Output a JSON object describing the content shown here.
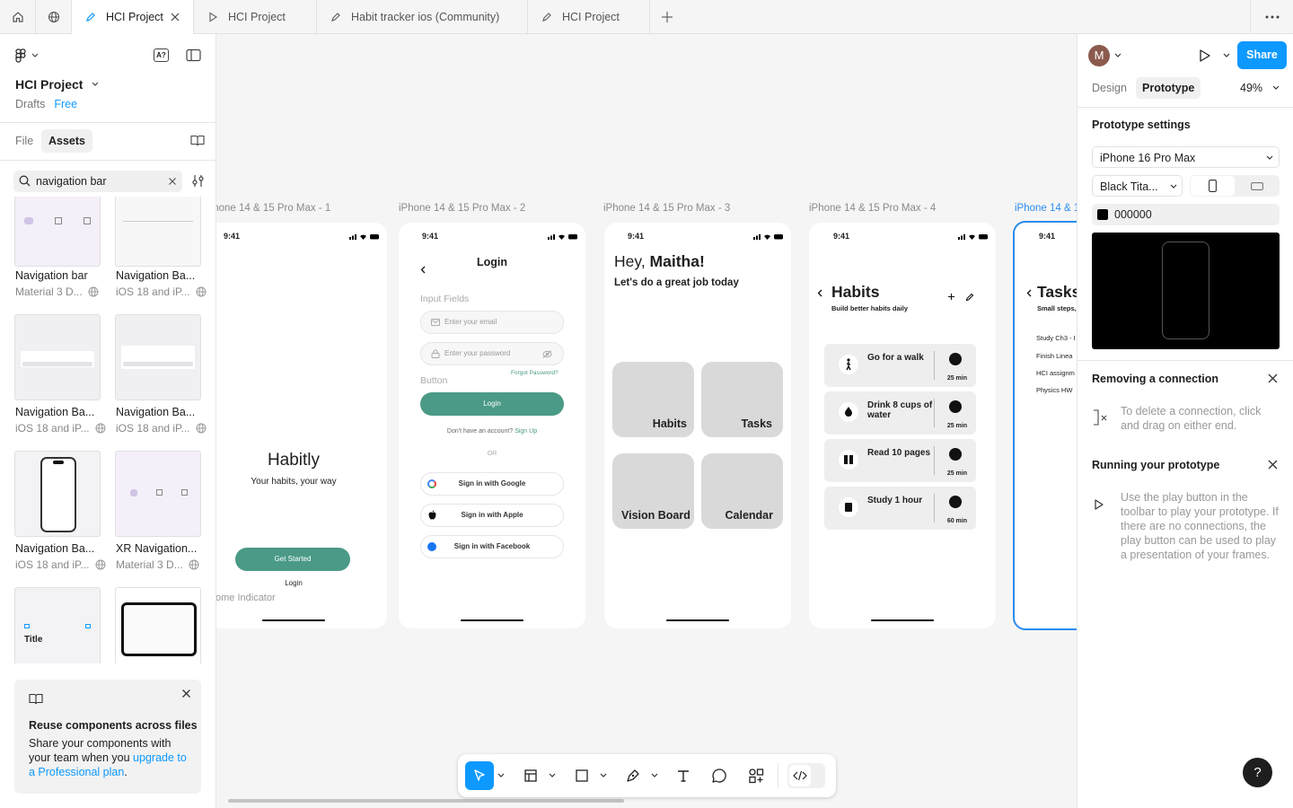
{
  "tabs": [
    {
      "label": "HCI Project"
    },
    {
      "label": "HCI Project"
    },
    {
      "label": "Habit tracker ios (Community)"
    },
    {
      "label": "HCI Project"
    }
  ],
  "left_panel": {
    "project_title": "HCI Project",
    "drafts": "Drafts",
    "plan": "Free",
    "tab_file": "File",
    "tab_assets": "Assets",
    "search_value": "navigation bar",
    "assets": [
      {
        "name": "Navigation bar",
        "sub": "Material 3 D..."
      },
      {
        "name": "Navigation Ba...",
        "sub": "iOS 18 and iP..."
      },
      {
        "name": "Navigation Ba...",
        "sub": "iOS 18 and iP..."
      },
      {
        "name": "Navigation Ba...",
        "sub": "iOS 18 and iP..."
      },
      {
        "name": "Navigation Ba...",
        "sub": "iOS 18 and iP..."
      },
      {
        "name": "XR Navigation...",
        "sub": "Material 3 D..."
      }
    ],
    "title_thumb_text": "Title",
    "promo": {
      "title": "Reuse components across files",
      "body": "Share your components with your team when you ",
      "link": "upgrade to a Professional plan",
      "end": "."
    }
  },
  "canvas": {
    "frame_labels": [
      "iPhone 14 & 15 Pro Max - 1",
      "iPhone 14 & 15 Pro Max - 2",
      "iPhone 14 & 15 Pro Max - 3",
      "iPhone 14 & 15 Pro Max - 4",
      "iPhone 14 & 1"
    ],
    "time": "9:41",
    "screen1": {
      "title": "Habitly",
      "subtitle": "Your habits, your way",
      "cta": "Get Started",
      "login": "Login",
      "home_indicator": "ome Indicator"
    },
    "screen2": {
      "title": "Login",
      "section1": "Input Fields",
      "email_ph": "Enter your email",
      "password_ph": "Enter your password",
      "forgot": "Forgot Password?",
      "section2": "Button",
      "login_btn": "Login",
      "no_account": "Don't have an account?",
      "sign_up": "Sign Up",
      "or": "OR",
      "google": "Sign in with Google",
      "apple": "Sign in with Apple",
      "facebook": "Sign in with Facebook"
    },
    "screen3": {
      "greet": "Hey, ",
      "name": "Maitha!",
      "sub": "Let's do a great job today",
      "tiles": [
        "Habits",
        "Tasks",
        "Vision Board",
        "Calendar"
      ]
    },
    "screen4": {
      "title": "Habits",
      "sub": "Build better habits daily",
      "habits": [
        {
          "name": "Go for a walk",
          "mins": "25 min"
        },
        {
          "name": "Drink 8 cups of water",
          "mins": "25 min"
        },
        {
          "name": "Read 10 pages",
          "mins": "25 min"
        },
        {
          "name": "Study 1 hour",
          "mins": "60 min"
        }
      ]
    },
    "screen5": {
      "title": "Tasks",
      "sub": "Small steps,",
      "items": [
        "Study Ch3 - I",
        "Finish Linea",
        "HCI assignm",
        "Physics HW"
      ]
    }
  },
  "right_panel": {
    "avatar": "M",
    "share": "Share",
    "tab_design": "Design",
    "tab_prototype": "Prototype",
    "zoom": "49%",
    "settings_title": "Prototype settings",
    "device": "iPhone 16 Pro Max",
    "color_model": "Black Tita...",
    "bg_hex": "000000",
    "removing_title": "Removing a connection",
    "removing_body": "To delete a connection, click and drag on either end.",
    "running_title": "Running your prototype",
    "running_body": "Use the play button in the toolbar to play your prototype. If there are no connections, the play button can be used to play a presentation of your frames."
  },
  "colors": {
    "accent": "#0d99ff",
    "teal": "#4a9a87",
    "selection": "#2a8cf0"
  }
}
